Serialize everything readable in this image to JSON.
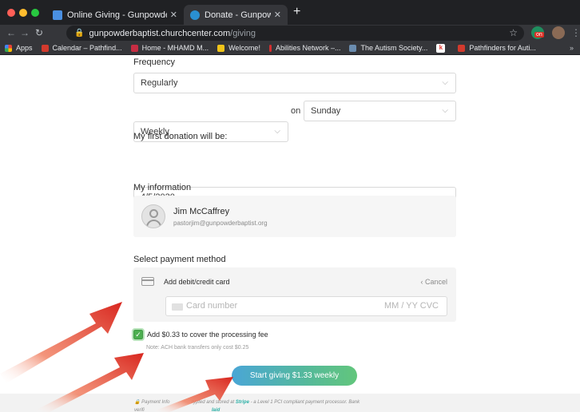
{
  "browser": {
    "tabs": [
      {
        "title": "Online Giving - Gunpowder Bapti",
        "active": false
      },
      {
        "title": "Donate - Gunpowder Baptist Chu",
        "active": true
      }
    ],
    "new_tab_icon": "plus-icon",
    "url_host": "gunpowderbaptist.churchcenter.com",
    "url_path": "/giving",
    "extension_badge": "on"
  },
  "bookmarks": [
    {
      "label": "Apps",
      "color": "#e44d26"
    },
    {
      "label": "Calendar – Pathfind...",
      "color": "#d23a2d"
    },
    {
      "label": "Home - MHAMD M...",
      "color": "#c62d43"
    },
    {
      "label": "Welcome!",
      "color": "#f0c419"
    },
    {
      "label": "Abilities Network –...",
      "color": "#d32f2f"
    },
    {
      "label": "The Autism Society...",
      "color": "#6a8caf"
    },
    {
      "label": "k",
      "color": "#e53935"
    },
    {
      "label": "Pathfinders for Auti...",
      "color": "#d23a2d"
    }
  ],
  "form": {
    "frequency_label": "Frequency",
    "frequency_value": "Regularly",
    "interval_value": "Weekly",
    "on_label": "on",
    "day_value": "Sunday",
    "first_donation_label": "My first donation will be:",
    "first_donation_value": "4/5/2020",
    "my_info_label": "My information",
    "user_name": "Jim McCaffrey",
    "user_email": "pastorjim@gunpowderbaptist.org",
    "payment_label": "Select payment method",
    "add_card_label": "Add debit/credit card",
    "cancel_label": "Cancel",
    "card_number_placeholder": "Card number",
    "card_exp_placeholder": "MM / YY  CVC",
    "fee_checkbox_label": "Add $0.33 to cover the processing fee",
    "fee_checked": true,
    "fee_note": "Note: ACH bank transfers only cost $0.25",
    "submit_label": "Start giving $1.33 weekly"
  },
  "footer": {
    "text_before": "Payment Info",
    "text_mid": "rypted and stored at",
    "stripe": "Stripe",
    "text_after": "- a Level 1 PCI compliant payment processor. Bank",
    "line2_a": "verifi",
    "line2_b": "laid"
  },
  "annotation_arrow_color": "#e0352b"
}
